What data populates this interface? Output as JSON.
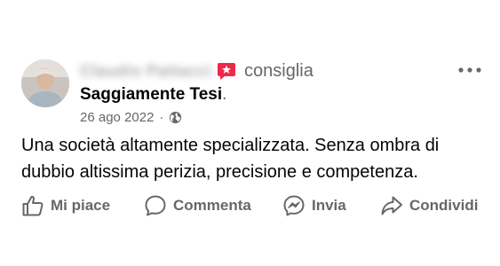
{
  "post": {
    "author_name": "Claudio Pattacci",
    "action_text": "consiglia",
    "page_name": "Saggiamente Tesi",
    "page_suffix": ".",
    "date": "26 ago 2022",
    "separator": "·",
    "privacy_icon": "globe-icon",
    "recommend_icon": "recommend-star-icon",
    "more_icon": "more-options-icon",
    "text_lines": [
      "Una società altamente specializzata. Senza ombra di",
      "dubbio altissima perizia, precisione e competenza."
    ]
  },
  "actions": {
    "like": "Mi piace",
    "comment": "Commenta",
    "send": "Invia",
    "share": "Condividi"
  },
  "colors": {
    "recommend_accent": "#f02849",
    "secondary_text": "#65676b",
    "primary_text": "#050505"
  }
}
